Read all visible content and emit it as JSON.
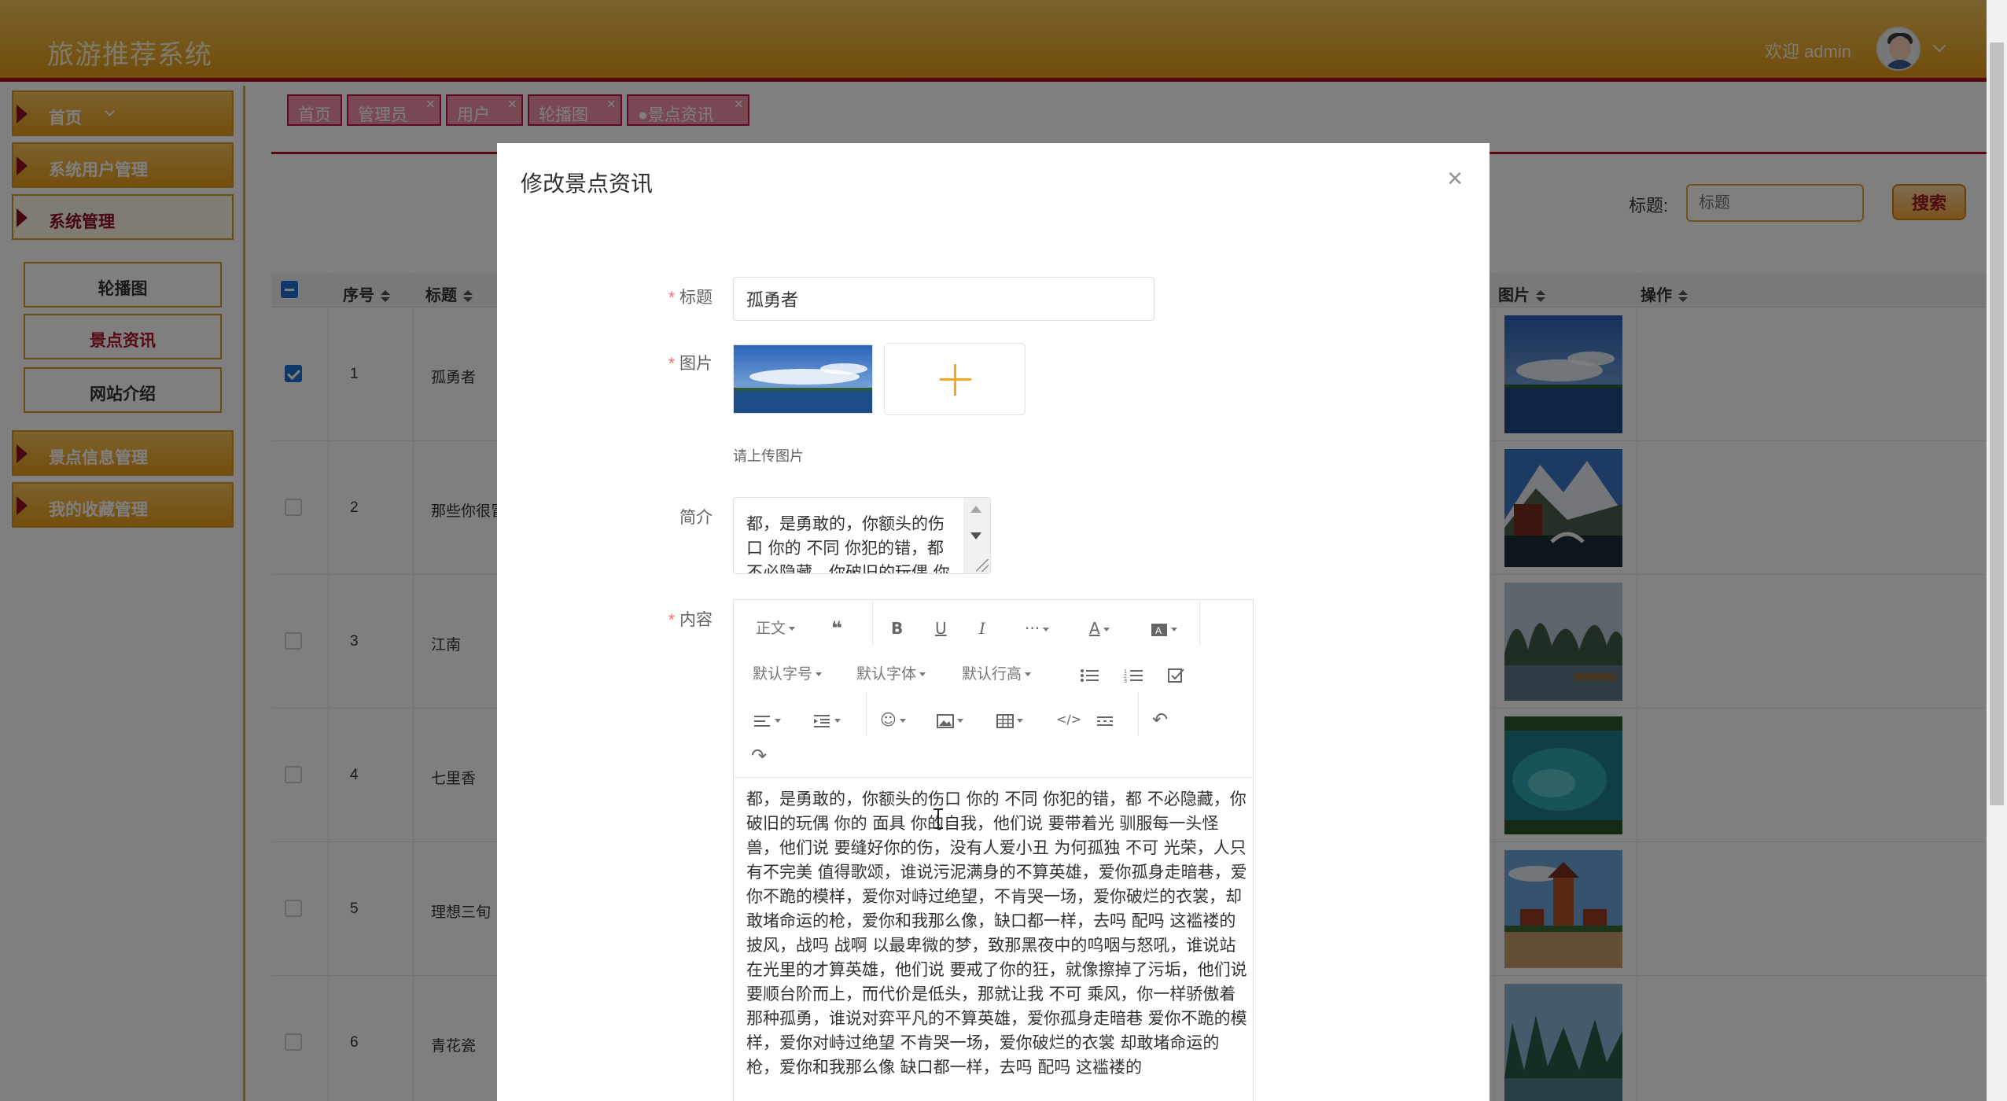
{
  "header": {
    "app_title": "旅游推荐系统",
    "welcome": "欢迎 admin"
  },
  "sidebar": {
    "items": [
      {
        "label": "首页"
      },
      {
        "label": "系统用户管理"
      },
      {
        "label": "系统管理"
      },
      {
        "label": "景点信息管理"
      },
      {
        "label": "我的收藏管理"
      }
    ],
    "submenu": [
      {
        "label": "轮播图"
      },
      {
        "label": "景点资讯"
      },
      {
        "label": "网站介绍"
      }
    ]
  },
  "tabs": [
    {
      "label": "首页"
    },
    {
      "label": "管理员",
      "close": "×"
    },
    {
      "label": "用户",
      "close": "×"
    },
    {
      "label": "轮播图",
      "close": "×"
    },
    {
      "label": "●景点资讯",
      "close": "×"
    }
  ],
  "search": {
    "label": "标题:",
    "placeholder": "标题",
    "button": "搜索"
  },
  "table": {
    "columns": [
      "序号",
      "标题",
      "图片",
      "操作"
    ],
    "rows": [
      {
        "num": "1",
        "title": "孤勇者",
        "checked": true
      },
      {
        "num": "2",
        "title": "那些你很冒",
        "checked": false
      },
      {
        "num": "3",
        "title": "江南",
        "checked": false
      },
      {
        "num": "4",
        "title": "七里香",
        "checked": false
      },
      {
        "num": "5",
        "title": "理想三旬",
        "checked": false
      },
      {
        "num": "6",
        "title": "青花瓷",
        "checked": false
      }
    ]
  },
  "dialog": {
    "title": "修改景点资讯",
    "close": "×",
    "form": {
      "title_label": "标题",
      "title_value": "孤勇者",
      "image_label": "图片",
      "upload_tip": "请上传图片",
      "intro_label": "简介",
      "intro_value": "都，是勇敢的，你额头的伤口 你的 不同 你犯的错，都 不必隐藏，你破旧的玩偶 你",
      "content_label": "内容",
      "required_mark": "*"
    },
    "editor": {
      "toolbar": {
        "paragraph": "正文",
        "font_size": "默认字号",
        "font_family": "默认字体",
        "line_height": "默认行高",
        "more": "···"
      },
      "content": "都，是勇敢的，你额头的伤口 你的 不同 你犯的错，都 不必隐藏，你破旧的玩偶 你的 面具 你的自我，他们说 要带着光 驯服每一头怪兽，他们说 要缝好你的伤，没有人爱小丑 为何孤独 不可 光荣，人只有不完美 值得歌颂，谁说污泥满身的不算英雄，爱你孤身走暗巷，爱你不跪的模样，爱你对峙过绝望，不肯哭一场，爱你破烂的衣裳，却敢堵命运的枪，爱你和我那么像，缺口都一样，去吗 配吗 这褴褛的披风，战吗 战啊 以最卑微的梦，致那黑夜中的呜咽与怒吼，谁说站在光里的才算英雄，他们说 要戒了你的狂，就像擦掉了污垢，他们说 要顺台阶而上，而代价是低头，那就让我 不可 乘风，你一样骄傲着 那种孤勇，谁说对弈平凡的不算英雄，爱你孤身走暗巷 爱你不跪的模样，爱你对峙过绝望 不肯哭一场，爱你破烂的衣裳 却敢堵命运的枪，爱你和我那么像 缺口都一样，去吗 配吗 这褴褛的"
    }
  },
  "colors": {
    "header_gradient_top": "#f3c45a",
    "header_gradient_bottom": "#e39a18",
    "accent_red": "#b41224",
    "tab_pink": "#f090a6",
    "plus_orange": "#f5a623"
  }
}
